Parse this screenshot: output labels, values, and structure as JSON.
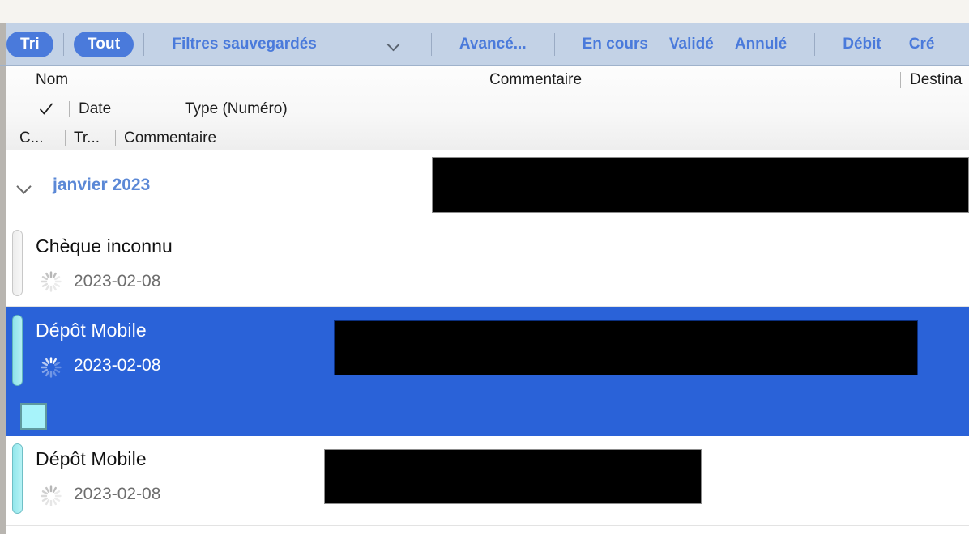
{
  "window": {
    "title": ""
  },
  "toolbar": {
    "sort_pill": "Tri",
    "all_pill": "Tout",
    "saved_filters": "Filtres sauvegardés",
    "saved_filters_chevron_icon": "chevron-down-icon",
    "advanced": "Avancé...",
    "in_progress": "En cours",
    "validated": "Validé",
    "cancelled": "Annulé",
    "debit": "Débit",
    "credit": "Cré",
    "accent_color": "#4a7adb",
    "bar_color": "#c3d2e6"
  },
  "headers": {
    "row1": {
      "name": "Nom",
      "comment": "Commentaire",
      "recipient": "Destina"
    },
    "row2": {
      "check_icon": "checkmark-icon",
      "date": "Date",
      "type": "Type (Numéro)"
    },
    "row3": {
      "col_c": "C...",
      "col_tr": "Tr...",
      "comment": "Commentaire"
    }
  },
  "list": {
    "group": {
      "label": "janvier 2023",
      "expanded": true,
      "disclosure_icon": "chevron-down-icon",
      "redacted": true
    },
    "rows": [
      {
        "name": "Chèque inconnu",
        "date": "2023-02-08",
        "status_icon": "loading-spinner-icon",
        "marker_color": "#f0f0f0",
        "selected": false,
        "redacted": false,
        "swatch": false
      },
      {
        "name": "Dépôt Mobile",
        "date": "2023-02-08",
        "status_icon": "loading-spinner-icon",
        "marker_color": "#93e7ec",
        "selected": true,
        "redacted": true,
        "swatch": true,
        "swatch_color": "#a7f3fa"
      },
      {
        "name": "Dépôt Mobile",
        "date": "2023-02-08",
        "status_icon": "loading-spinner-icon",
        "marker_color": "#93e7ec",
        "selected": false,
        "redacted": true,
        "swatch": false
      }
    ],
    "selection_color": "#2a62d8"
  }
}
